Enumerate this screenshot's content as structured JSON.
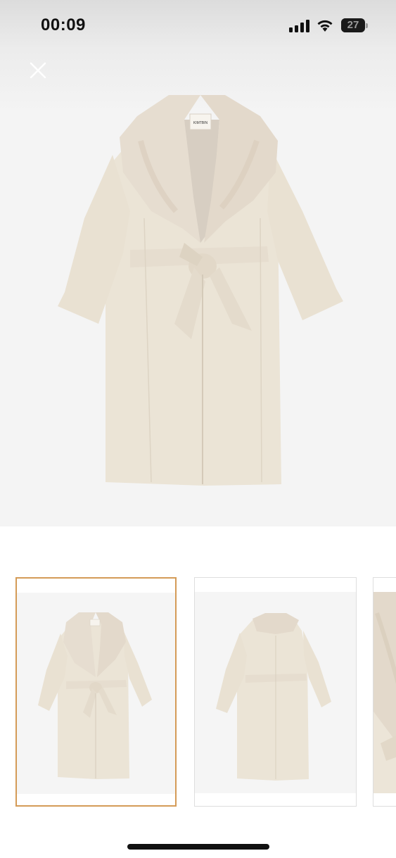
{
  "status_bar": {
    "time": "00:09",
    "battery_level": "27",
    "battery_fraction": 0.27
  },
  "icons": {
    "close": "close-icon",
    "signal": "cellular-signal-icon",
    "wifi": "wifi-icon",
    "battery": "battery-icon"
  },
  "product": {
    "label_text": "KIMTBIN"
  },
  "gallery": {
    "selected_index": 0,
    "thumbnails": [
      {
        "view": "front"
      },
      {
        "view": "back"
      },
      {
        "view": "detail"
      }
    ]
  },
  "colors": {
    "coat": "#ebe4d6",
    "fur": "#e6ddd0",
    "selected_border": "#d49b57",
    "hero_background": "#f4f4f4"
  }
}
